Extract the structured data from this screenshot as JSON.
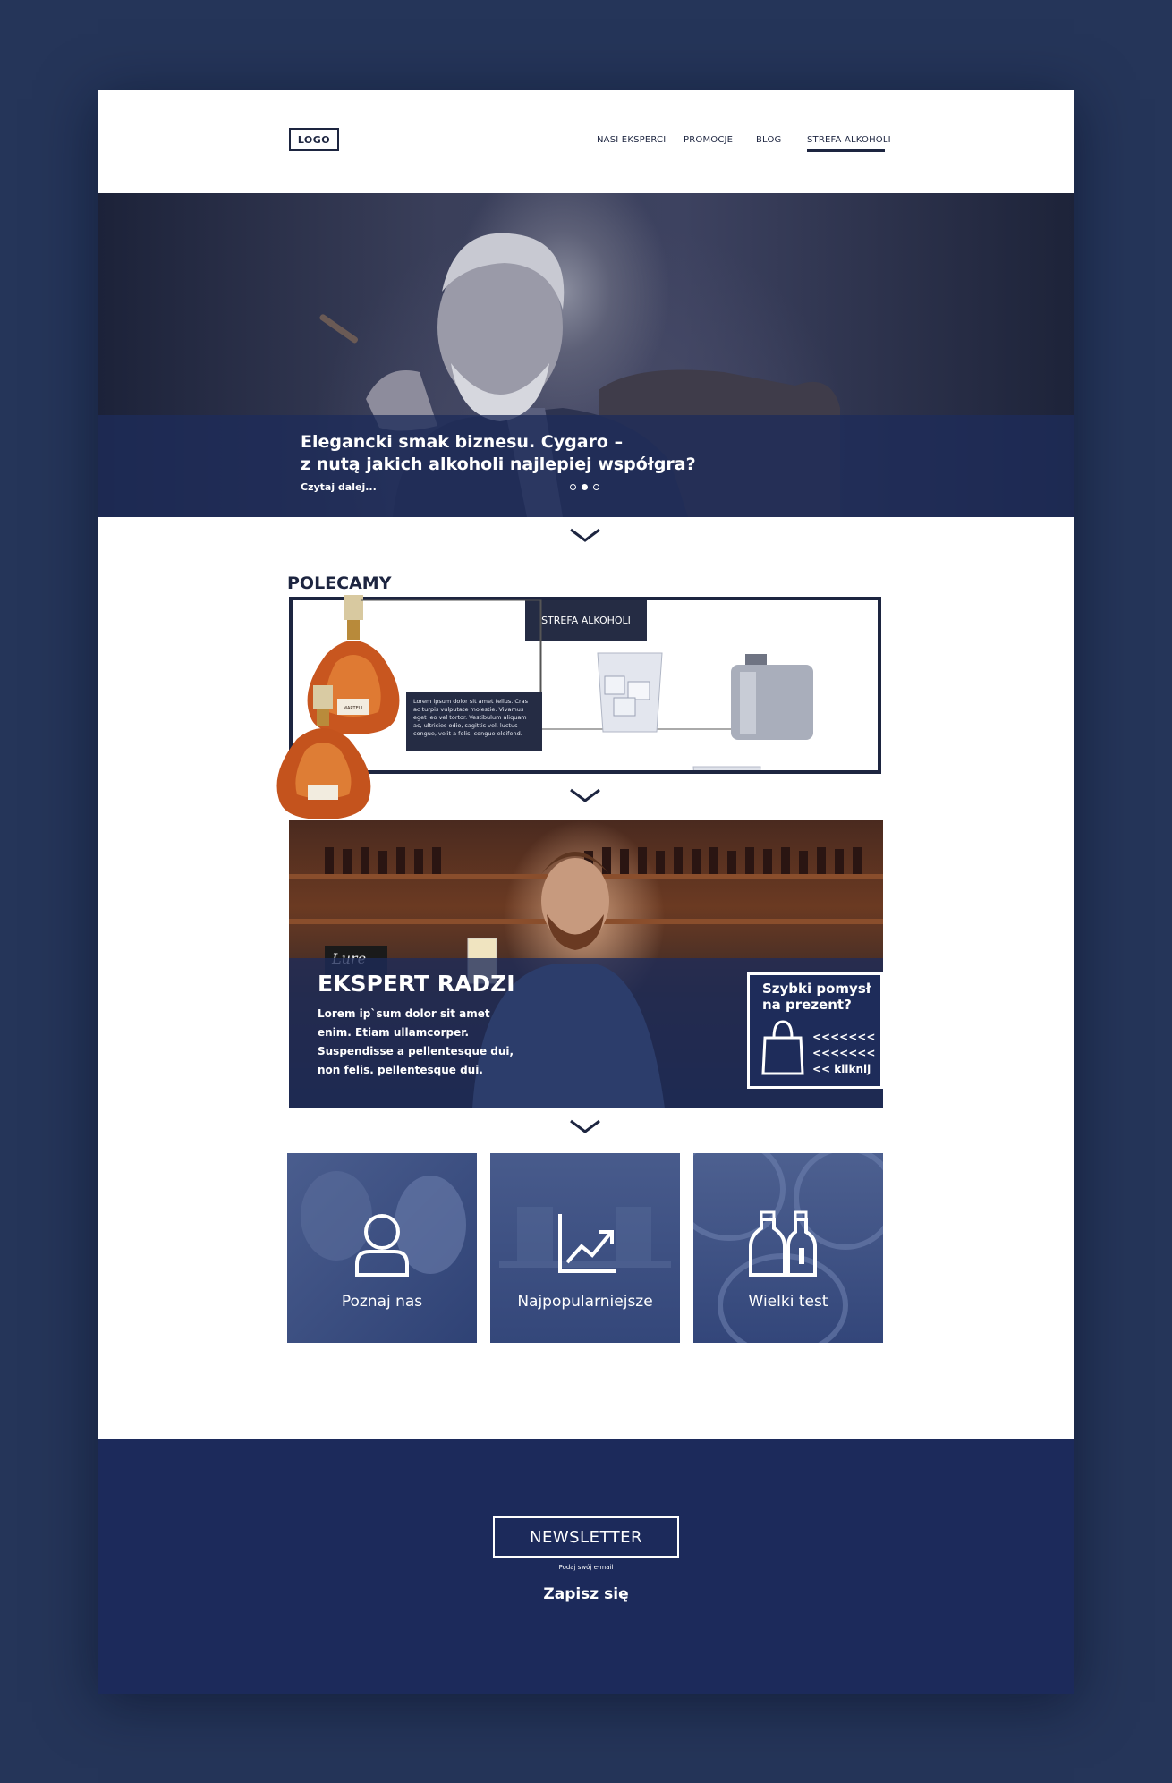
{
  "header": {
    "logo": "LOGO",
    "nav": [
      {
        "label": "NASI EKSPERCI"
      },
      {
        "label": "PROMOCJE"
      },
      {
        "label": "BLOG"
      },
      {
        "label": "STREFA ALKOHOLI",
        "active": true
      }
    ]
  },
  "hero": {
    "title": "Elegancki smak biznesu. Cygaro –\nz nutą jakich alkoholi najlepiej współgra?",
    "link": "Czytaj dalej...",
    "slides_total": 3,
    "active_slide": 2
  },
  "recommended": {
    "title": "POLECAMY",
    "category_label": "STREFA ALKOHOLI",
    "bottle_brand": "MARTELL",
    "description": "Lorem ipsum dolor sit amet tellus. Cras ac turpis vulputate molestie. Vivamus eget leo vel tortor. Vestibulum aliquam ac, ultricies odio, sagittis vel, luctus congue, velit a felis. congue eleifend."
  },
  "expert": {
    "title": "EKSPERT RADZI",
    "text": "Lorem ip`sum dolor sit amet enim. Etiam ullamcorper. Suspendisse a pellentesque dui, non felis. pellentesque dui.",
    "bar_sign": "Lure",
    "gift_title": "Szybki pomysł na prezent?",
    "gift_arrows_1": "<<<<<<<",
    "gift_arrows_2": "<<<<<<<",
    "gift_cta": "<< kliknij"
  },
  "tiles": [
    {
      "label": "Poznaj nas",
      "icon": "user-icon"
    },
    {
      "label": "Najpopularniejsze",
      "icon": "chart-trend-icon"
    },
    {
      "label": "Wielki test",
      "icon": "bottles-icon"
    }
  ],
  "newsletter": {
    "title": "NEWSLETTER",
    "hint": "Podaj swój e-mail",
    "cta": "Zapisz się"
  },
  "colors": {
    "page_bg": "#253559",
    "navy": "#1d2540",
    "overlay_blue": "#1e2c5a",
    "footer_blue": "#1c2a5b"
  }
}
